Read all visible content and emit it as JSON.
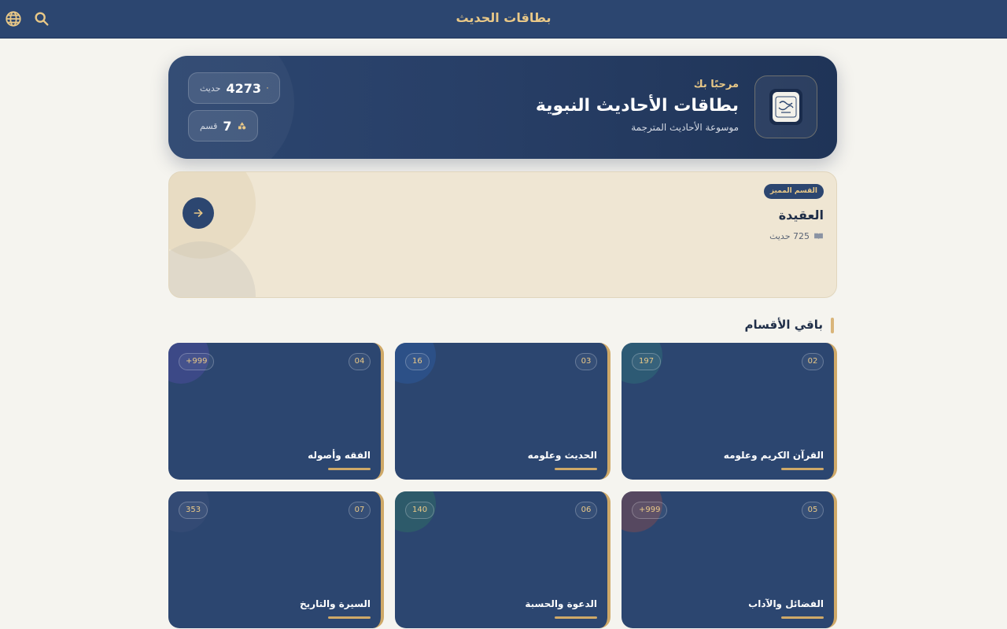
{
  "header": {
    "title": "بطاقات الحديث",
    "globe_icon": "globe-icon",
    "search_icon": "search-icon"
  },
  "hero": {
    "greeting": "مرحبًا بك",
    "app_name": "بطاقات الأحاديث النبوية",
    "subtitle": "موسوعة الأحاديث المترجمة",
    "stats": {
      "hadith_count": "4273",
      "hadith_unit": "حديث",
      "section_count": "7",
      "section_unit": "قسم"
    }
  },
  "featured": {
    "badge": "القسم المميز",
    "name": "العقيدة",
    "count": "725 حديث"
  },
  "categories_title": "باقي الأقسام",
  "categories": [
    {
      "index": "02",
      "count": "197",
      "name": "القرآن الكريم وعلومه",
      "accent": "#2f6b78"
    },
    {
      "index": "03",
      "count": "16",
      "name": "الحديث وعلومه",
      "accent": "#2d5a9a"
    },
    {
      "index": "04",
      "count": "+999",
      "name": "الفقه وأصوله",
      "accent": "#4b4c9a"
    },
    {
      "index": "05",
      "count": "+999",
      "name": "الفضائل والآداب",
      "accent": "#7a4a54"
    },
    {
      "index": "06",
      "count": "140",
      "name": "الدعوة والحسبة",
      "accent": "#2f6b66"
    },
    {
      "index": "07",
      "count": "353",
      "name": "السيرة والتاريخ",
      "accent": "#3a4f78"
    }
  ],
  "colors": {
    "primary": "#2c4670",
    "gold": "#e9c887",
    "background": "#f5f4ef",
    "featured_bg": "#efe6d3"
  }
}
